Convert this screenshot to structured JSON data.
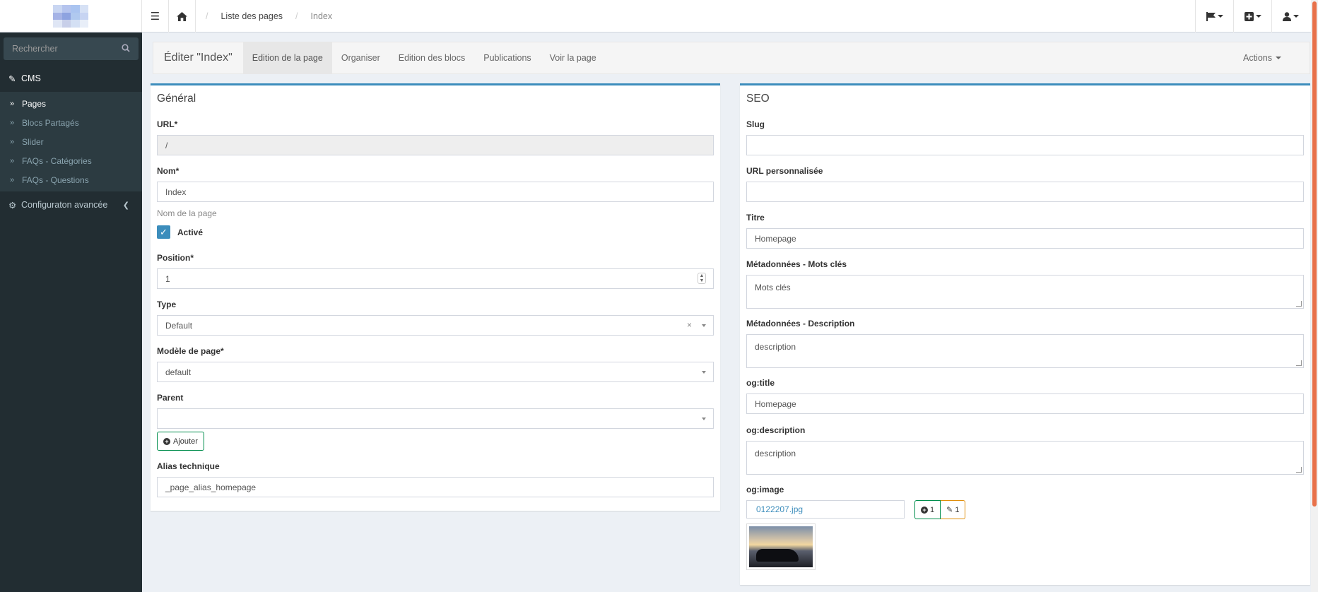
{
  "header": {
    "breadcrumb": {
      "level1": "Liste des pages",
      "level2": "Index"
    }
  },
  "sidebar": {
    "search_placeholder": "Rechercher",
    "cms_label": "CMS",
    "items": [
      {
        "label": "Pages"
      },
      {
        "label": "Blocs Partagés"
      },
      {
        "label": "Slider"
      },
      {
        "label": "FAQs - Catégories"
      },
      {
        "label": "FAQs - Questions"
      }
    ],
    "advanced_label": "Configuraton avancée"
  },
  "toolbar": {
    "title": "Éditer \"Index\"",
    "tabs": [
      {
        "label": "Edition de la page"
      },
      {
        "label": "Organiser"
      },
      {
        "label": "Edition des blocs"
      },
      {
        "label": "Publications"
      },
      {
        "label": "Voir la page"
      }
    ],
    "actions_label": "Actions"
  },
  "general": {
    "title": "Général",
    "url": {
      "label": "URL*",
      "value": "/"
    },
    "nom": {
      "label": "Nom*",
      "value": "Index",
      "help": "Nom de la page"
    },
    "active": {
      "label": "Activé",
      "checked": true
    },
    "position": {
      "label": "Position*",
      "value": "1"
    },
    "type": {
      "label": "Type",
      "value": "Default"
    },
    "template": {
      "label": "Modèle de page*",
      "value": "default"
    },
    "parent": {
      "label": "Parent",
      "value": ""
    },
    "add_button": "Ajouter",
    "alias": {
      "label": "Alias technique",
      "value": "_page_alias_homepage"
    }
  },
  "seo": {
    "title": "SEO",
    "slug": {
      "label": "Slug",
      "value": ""
    },
    "custom_url": {
      "label": "URL personnalisée",
      "value": ""
    },
    "titre": {
      "label": "Titre",
      "value": "Homepage"
    },
    "meta_keywords": {
      "label": "Métadonnées - Mots clés",
      "value": "Mots clés"
    },
    "meta_description": {
      "label": "Métadonnées - Description",
      "value": "description"
    },
    "og_title": {
      "label": "og:title",
      "value": "Homepage"
    },
    "og_description": {
      "label": "og:description",
      "value": "description"
    },
    "og_image": {
      "label": "og:image",
      "file": "0122207.jpg",
      "add_count": "1",
      "edit_count": "1"
    }
  },
  "colors": {
    "primary": "#3c8dbc",
    "sidebar": "#222d32",
    "success": "#008d4c",
    "warning": "#e08e0b"
  }
}
